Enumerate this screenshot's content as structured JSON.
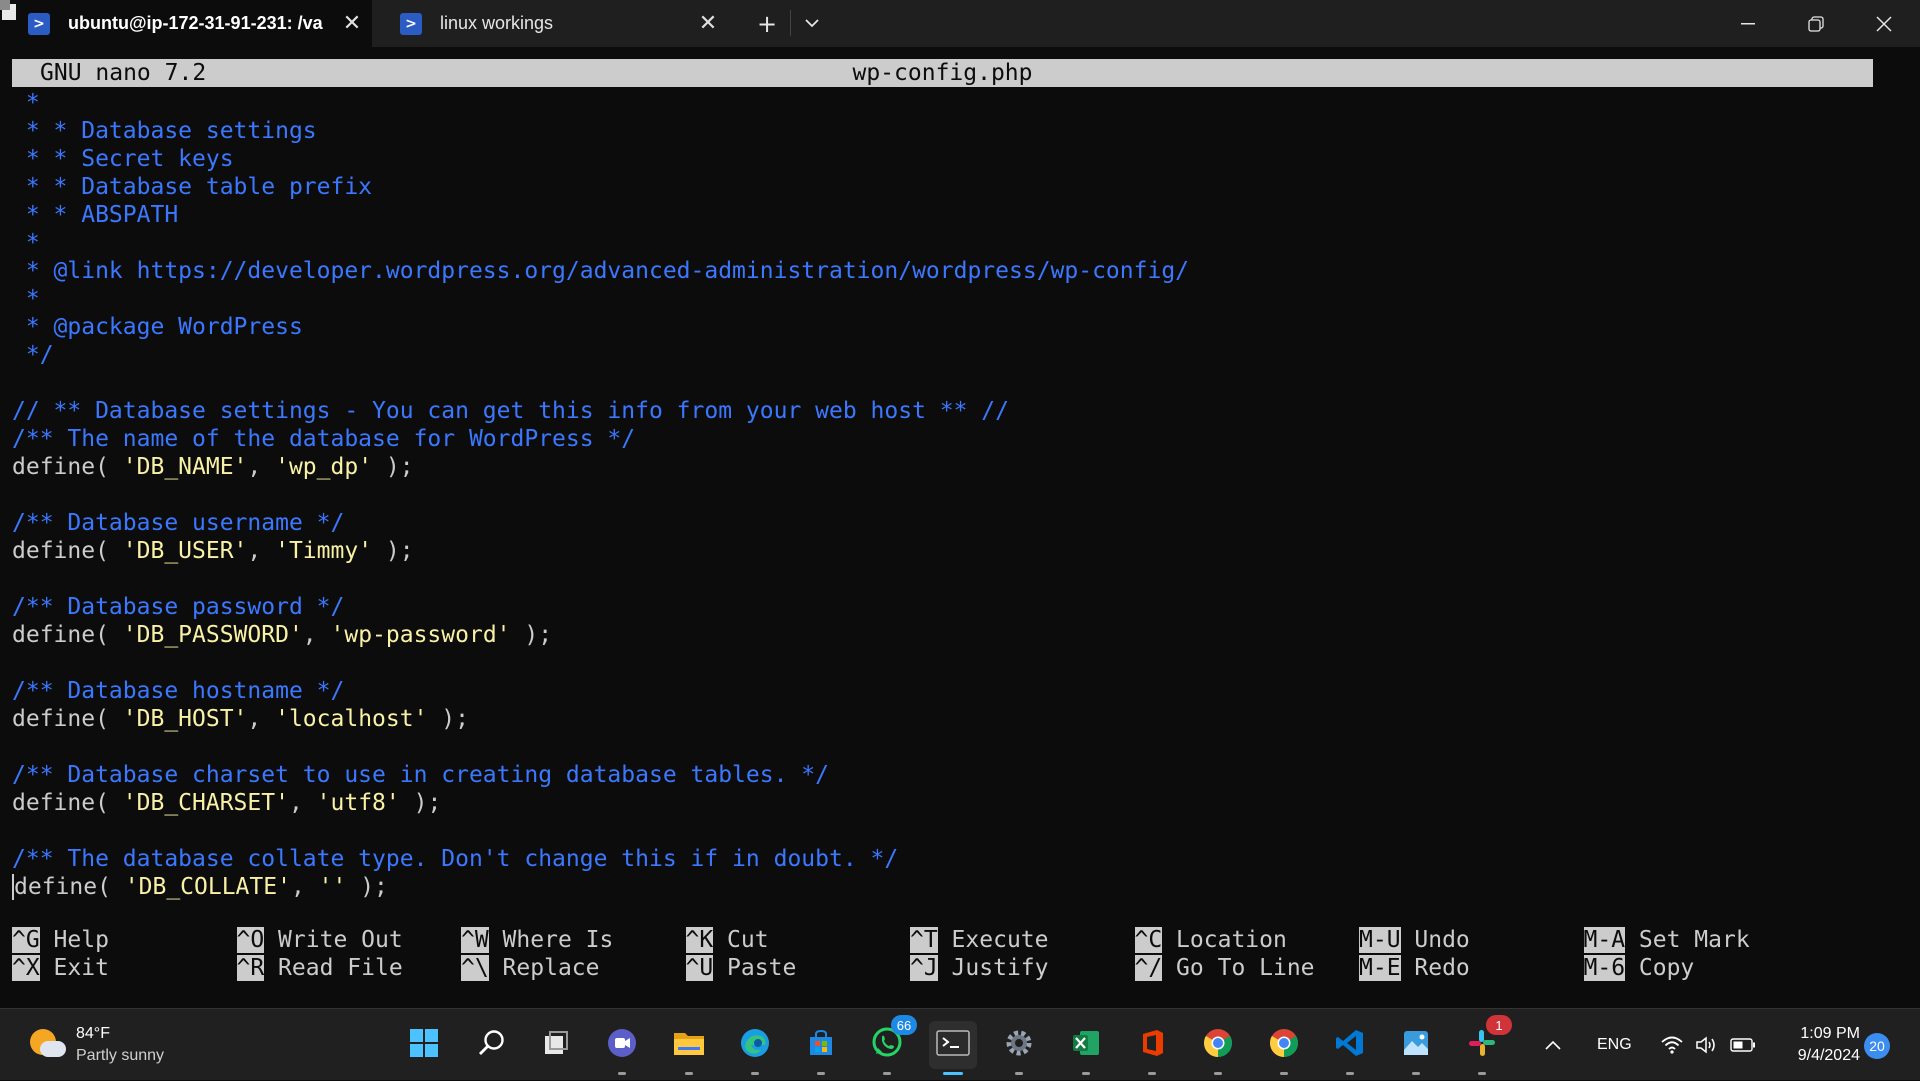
{
  "window": {
    "tabs": [
      {
        "title": "ubuntu@ip-172-31-91-231: /va",
        "icon": "powershell-icon",
        "active": true
      },
      {
        "title": "linux workings",
        "icon": "powershell-icon",
        "active": false
      }
    ],
    "close_glyph": "✕",
    "new_tab_glyph": "+",
    "dropdown_glyph": "⌄",
    "minimize_glyph": "—",
    "restore_glyph": "❐",
    "window_close_glyph": "✕"
  },
  "nano": {
    "version": "GNU nano 7.2",
    "filename": "wp-config.php",
    "lines": [
      [
        {
          "t": " *",
          "k": "c"
        }
      ],
      [
        {
          "t": " * * Database settings",
          "k": "c"
        }
      ],
      [
        {
          "t": " * * Secret keys",
          "k": "c"
        }
      ],
      [
        {
          "t": " * * Database table prefix",
          "k": "c"
        }
      ],
      [
        {
          "t": " * * ABSPATH",
          "k": "c"
        }
      ],
      [
        {
          "t": " *",
          "k": "c"
        }
      ],
      [
        {
          "t": " * @link https://developer.wordpress.org/advanced-administration/wordpress/wp-config/",
          "k": "c"
        }
      ],
      [
        {
          "t": " *",
          "k": "c"
        }
      ],
      [
        {
          "t": " * @package WordPress",
          "k": "c"
        }
      ],
      [
        {
          "t": " */",
          "k": "c"
        }
      ],
      [],
      [
        {
          "t": "// ** Database settings - You can get this info from your web host ** //",
          "k": "c"
        }
      ],
      [
        {
          "t": "/** The name of the database for WordPress */",
          "k": "c"
        }
      ],
      [
        {
          "t": "define( ",
          "k": "p"
        },
        {
          "t": "'DB_NAME'",
          "k": "s"
        },
        {
          "t": ", ",
          "k": "p"
        },
        {
          "t": "'wp_dp'",
          "k": "s"
        },
        {
          "t": " );",
          "k": "p"
        }
      ],
      [],
      [
        {
          "t": "/** Database username */",
          "k": "c"
        }
      ],
      [
        {
          "t": "define( ",
          "k": "p"
        },
        {
          "t": "'DB_USER'",
          "k": "s"
        },
        {
          "t": ", ",
          "k": "p"
        },
        {
          "t": "'Timmy'",
          "k": "s"
        },
        {
          "t": " );",
          "k": "p"
        }
      ],
      [],
      [
        {
          "t": "/** Database password */",
          "k": "c"
        }
      ],
      [
        {
          "t": "define( ",
          "k": "p"
        },
        {
          "t": "'DB_PASSWORD'",
          "k": "s"
        },
        {
          "t": ", ",
          "k": "p"
        },
        {
          "t": "'wp-password'",
          "k": "s"
        },
        {
          "t": " );",
          "k": "p"
        }
      ],
      [],
      [
        {
          "t": "/** Database hostname */",
          "k": "c"
        }
      ],
      [
        {
          "t": "define( ",
          "k": "p"
        },
        {
          "t": "'DB_HOST'",
          "k": "s"
        },
        {
          "t": ", ",
          "k": "p"
        },
        {
          "t": "'localhost'",
          "k": "s"
        },
        {
          "t": " );",
          "k": "p"
        }
      ],
      [],
      [
        {
          "t": "/** Database charset to use in creating database tables. */",
          "k": "c"
        }
      ],
      [
        {
          "t": "define( ",
          "k": "p"
        },
        {
          "t": "'DB_CHARSET'",
          "k": "s"
        },
        {
          "t": ", ",
          "k": "p"
        },
        {
          "t": "'utf8'",
          "k": "s"
        },
        {
          "t": " );",
          "k": "p"
        }
      ],
      [],
      [
        {
          "t": "/** The database collate type. Don't change this if in doubt. */",
          "k": "c"
        }
      ],
      [
        {
          "t": "define( ",
          "k": "p",
          "cursor": true
        },
        {
          "t": "'DB_COLLATE'",
          "k": "s"
        },
        {
          "t": ", ",
          "k": "p"
        },
        {
          "t": "''",
          "k": "s"
        },
        {
          "t": " );",
          "k": "p"
        }
      ]
    ],
    "shortcuts": [
      {
        "key": "^G",
        "label": "Help",
        "col": 0,
        "row": 0
      },
      {
        "key": "^X",
        "label": "Exit",
        "col": 0,
        "row": 1
      },
      {
        "key": "^O",
        "label": "Write Out",
        "col": 1,
        "row": 0
      },
      {
        "key": "^R",
        "label": "Read File",
        "col": 1,
        "row": 1
      },
      {
        "key": "^W",
        "label": "Where Is",
        "col": 2,
        "row": 0
      },
      {
        "key": "^\\",
        "label": "Replace",
        "col": 2,
        "row": 1
      },
      {
        "key": "^K",
        "label": "Cut",
        "col": 3,
        "row": 0
      },
      {
        "key": "^U",
        "label": "Paste",
        "col": 3,
        "row": 1
      },
      {
        "key": "^T",
        "label": "Execute",
        "col": 4,
        "row": 0
      },
      {
        "key": "^J",
        "label": "Justify",
        "col": 4,
        "row": 1
      },
      {
        "key": "^C",
        "label": "Location",
        "col": 5,
        "row": 0
      },
      {
        "key": "^/",
        "label": "Go To Line",
        "col": 5,
        "row": 1
      },
      {
        "key": "M-U",
        "label": "Undo",
        "col": 6,
        "row": 0
      },
      {
        "key": "M-E",
        "label": "Redo",
        "col": 6,
        "row": 1
      },
      {
        "key": "M-A",
        "label": "Set Mark",
        "col": 7,
        "row": 0
      },
      {
        "key": "M-6",
        "label": "Copy",
        "col": 7,
        "row": 1
      }
    ]
  },
  "taskbar": {
    "weather": {
      "temp": "84°F",
      "condition": "Partly sunny"
    },
    "apps": [
      {
        "name": "start-button",
        "icon": "windows-icon"
      },
      {
        "name": "search-button",
        "icon": "search-icon"
      },
      {
        "name": "task-view-button",
        "icon": "task-view-icon"
      },
      {
        "name": "meet-app",
        "icon": "video-chat-icon"
      },
      {
        "name": "file-explorer-app",
        "icon": "folder-icon"
      },
      {
        "name": "edge-app",
        "icon": "edge-icon"
      },
      {
        "name": "store-app",
        "icon": "store-icon"
      },
      {
        "name": "whatsapp-app",
        "icon": "whatsapp-icon",
        "badge": "66"
      },
      {
        "name": "terminal-app",
        "icon": "terminal-icon",
        "active": true
      },
      {
        "name": "settings-app",
        "icon": "gear-icon"
      },
      {
        "name": "excel-app",
        "icon": "excel-icon"
      },
      {
        "name": "office-app",
        "icon": "office-icon"
      },
      {
        "name": "chrome-app",
        "icon": "chrome-icon"
      },
      {
        "name": "chrome-profile-app",
        "icon": "chrome-icon"
      },
      {
        "name": "vscode-app",
        "icon": "vscode-icon"
      },
      {
        "name": "photos-app",
        "icon": "photos-icon"
      },
      {
        "name": "slack-app",
        "icon": "slack-icon",
        "badge": "1"
      }
    ],
    "tray": {
      "chevron": "^",
      "language": "ENG",
      "time": "1:09 PM",
      "date": "9/4/2024",
      "notifications": "20"
    }
  },
  "colors": {
    "comment": "#3b78ff",
    "string": "#f9f1a5",
    "plain": "#cccccc",
    "background": "#0c0c0c",
    "header_bg": "#cccccc"
  }
}
